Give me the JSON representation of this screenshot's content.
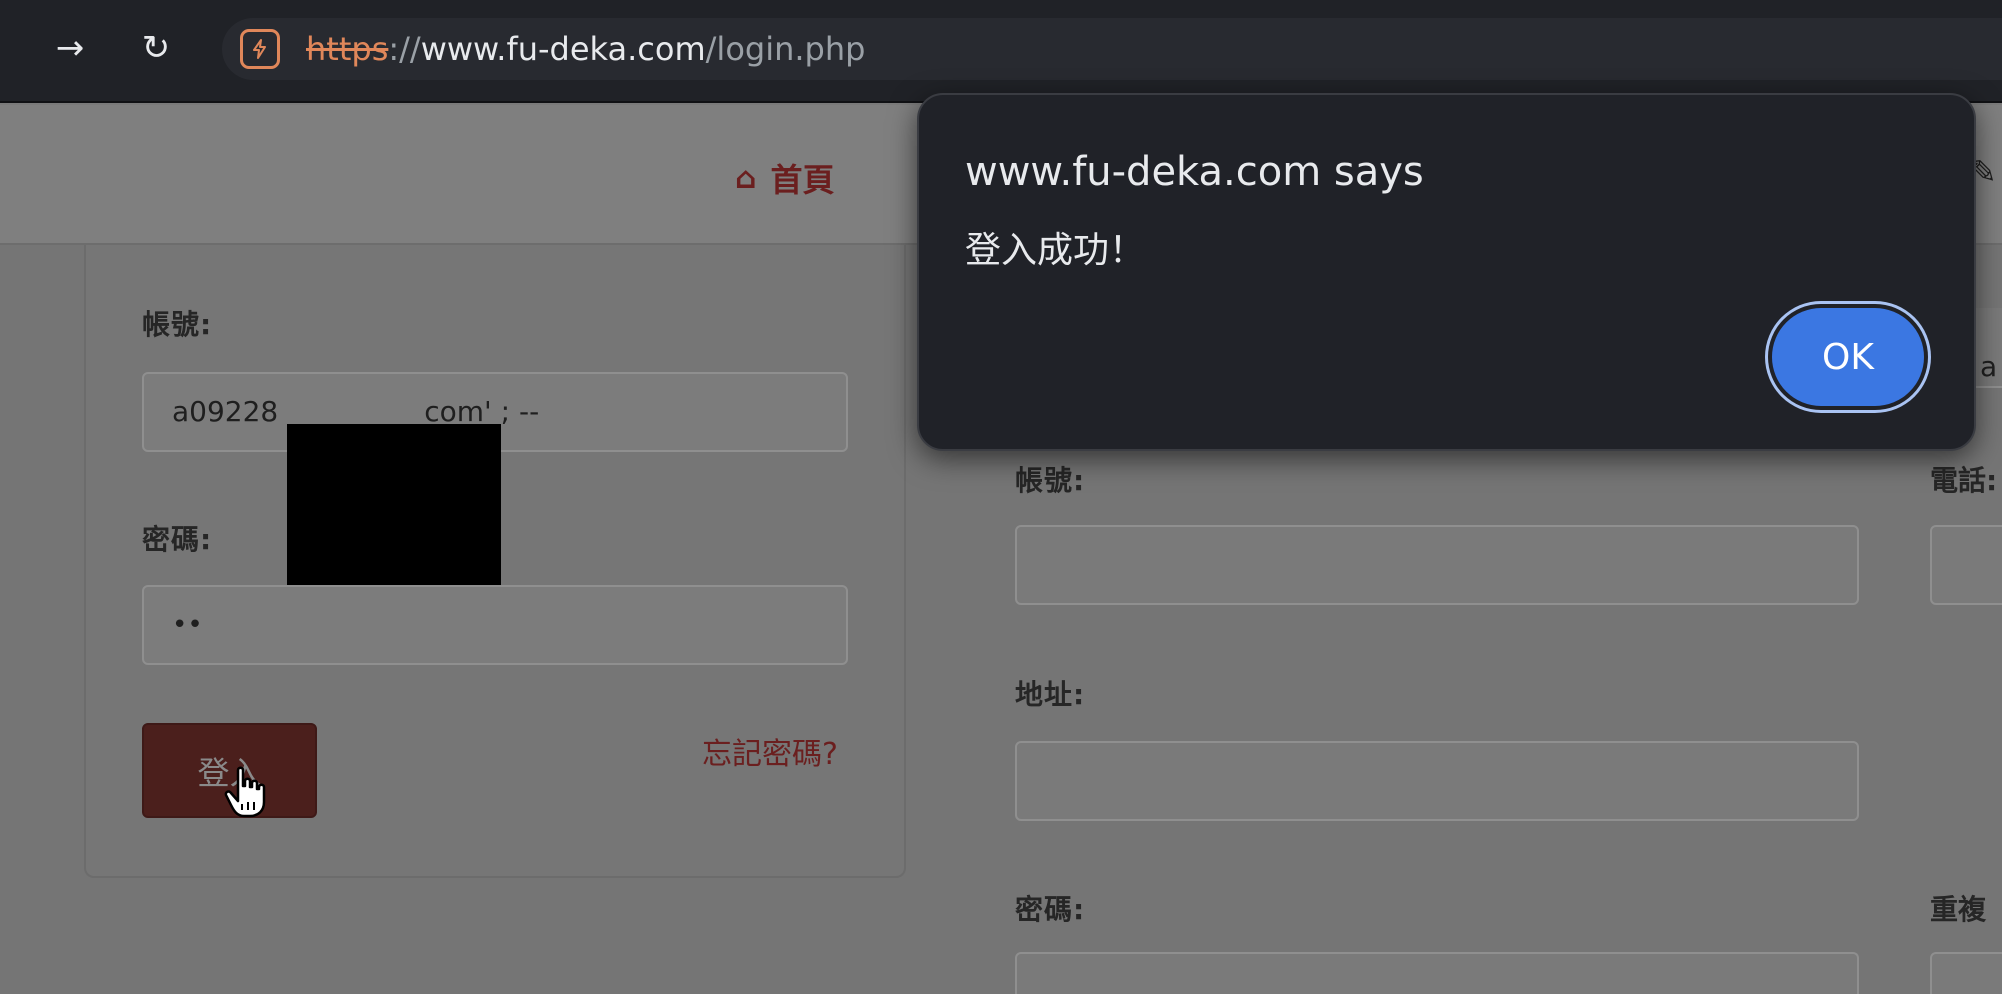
{
  "browser": {
    "url_scheme": "https",
    "url_separator": "://",
    "url_host": "www.fu-deka.com",
    "url_path": "/login.php",
    "forward_glyph": "→",
    "reload_glyph": "↻",
    "security_color": "#e0875a"
  },
  "site": {
    "nav_home_icon": "⌂",
    "nav_home_label": "首頁",
    "nav_edge_icon": "✎"
  },
  "login": {
    "account_label": "帳號:",
    "account_value_start": "a09228",
    "account_value_end": "com' ; --",
    "password_label": "密碼:",
    "password_value": "••",
    "login_button": "登入",
    "forgot_password": "忘記密碼?"
  },
  "register": {
    "account_label": "帳號:",
    "phone_label_partial": "電話:",
    "address_label": "地址:",
    "password_label": "密碼:",
    "repeat_label_partial": "重複",
    "edge_char": "a"
  },
  "dialog": {
    "title": "www.fu-deka.com says",
    "message": "登入成功！",
    "ok_label": "OK",
    "ok_color": "#3b77e2"
  }
}
